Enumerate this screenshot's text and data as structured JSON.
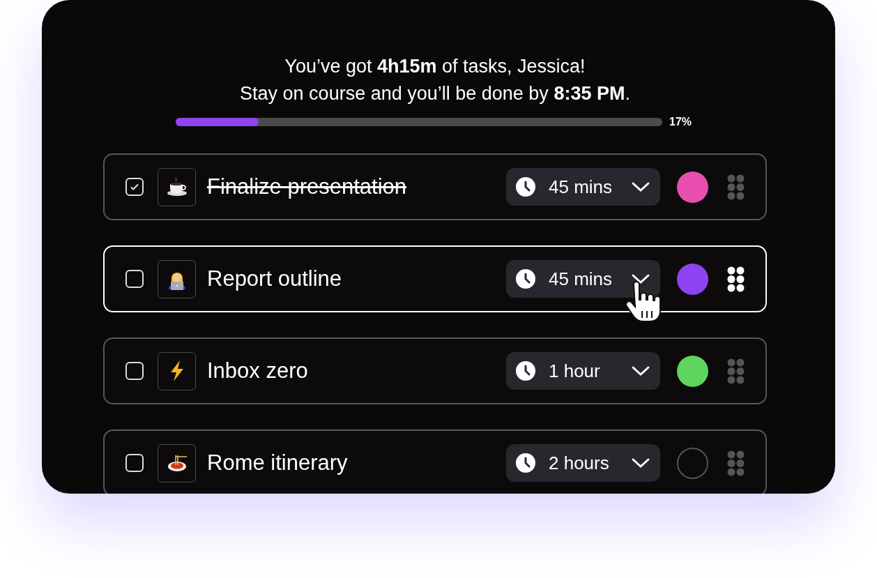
{
  "summary": {
    "line_1": "You’ve got **4h15m** of tasks, Jessica!",
    "line_2": "Stay on course and you’ll be done by **8:35 PM**."
  },
  "progress": {
    "level": 0.17,
    "reading": "17%"
  },
  "tasks": [
    {
      "title": "Finalize presentation",
      "checked": true,
      "highlighted": false,
      "hovered": false,
      "duration": "45 mins",
      "color": "#e94faf"
    },
    {
      "title": "Report outline",
      "checked": false,
      "highlighted": true,
      "hovered": true,
      "duration": "45 mins",
      "color": "#8e44f0"
    },
    {
      "title": "Inbox zero",
      "checked": false,
      "highlighted": false,
      "hovered": false,
      "duration": "1 hour",
      "color": "#5fd45f"
    },
    {
      "title": "Rome itinerary",
      "checked": false,
      "highlighted": false,
      "hovered": false,
      "duration": "2 hours"
    }
  ]
}
